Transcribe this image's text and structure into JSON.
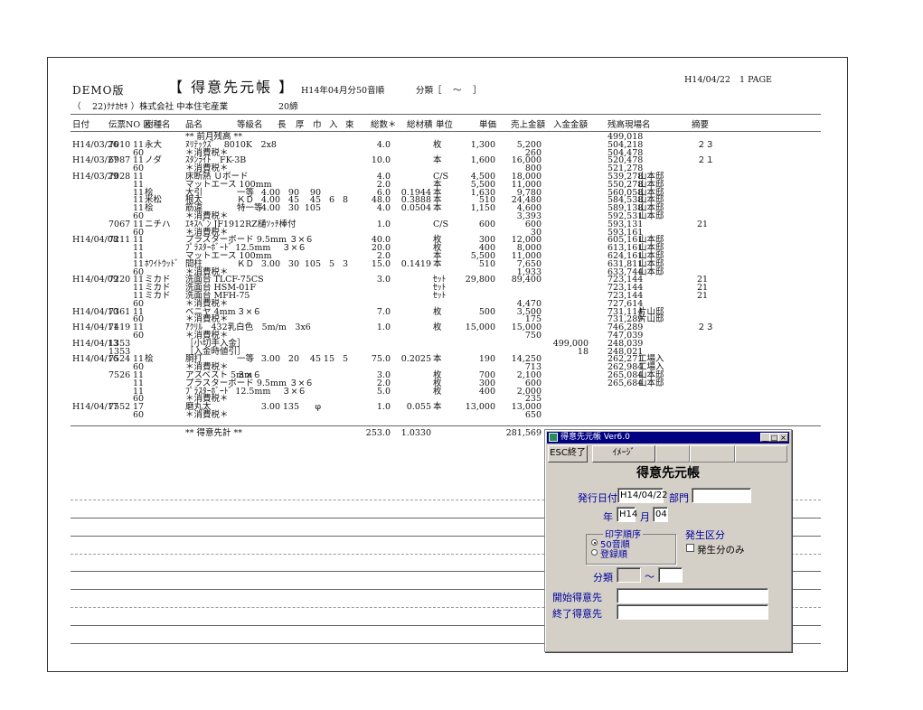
{
  "report": {
    "demo_label": "DEMO版",
    "title": "【 得意先元帳 】",
    "period": "H14年04月分",
    "sort": "50音順",
    "class_range": "分類［　 ～ 　］",
    "print_date": "H14/04/22",
    "page": "1 PAGE",
    "customer_code": "（ 　22)ｸﾅｶｾｷ ）株式会社 中本住宅産業",
    "closing": "20締",
    "columns": {
      "date": "日付",
      "slip": "伝票NO 区",
      "type": "樹種名",
      "item": "品名",
      "grade": "等級名",
      "length": "長",
      "thick": "厚",
      "width": "巾",
      "qty_in": "入",
      "bundle": "束",
      "total_qty": "総数＊",
      "total_vol": "総材積",
      "unit": "単位",
      "price": "単価",
      "sales": "売上金額",
      "deposit": "入金金額",
      "balance": "残高",
      "site": "現場名",
      "memo": "摘要"
    },
    "rows": [
      {
        "item": "** 前月残高 **",
        "balance": "499,018"
      },
      {
        "date": "H14/03/26",
        "slip": "7010",
        "kbn": "11",
        "type": "永大",
        "item": "ﾇﾘﾃｯｸｽﾞ　8010K　2x8",
        "qty": "4.0",
        "unit": "枚",
        "price": "1,300",
        "sales": "5,200",
        "balance": "504,218",
        "memo": "２３"
      },
      {
        "kbn": "60",
        "item": "＊消費税＊",
        "sales": "260",
        "balance": "504,478"
      },
      {
        "date": "H14/03/27",
        "slip": "6987",
        "kbn": "11",
        "type": "ノダ",
        "item": "ｽﾀﾝﾗｲﾄ　FK-3B",
        "qty": "10.0",
        "unit": "本",
        "price": "1,600",
        "sales": "16,000",
        "balance": "520,478",
        "memo": "２１"
      },
      {
        "kbn": "60",
        "item": "＊消費税＊",
        "sales": "800",
        "balance": "521,278"
      },
      {
        "date": "H14/03/29",
        "slip": "7028",
        "kbn": "11",
        "item": "床断熱 Ｕボード",
        "qty": "4.0",
        "unit": "C/S",
        "price": "4,500",
        "sales": "18,000",
        "balance": "539,278",
        "site": "山本邸"
      },
      {
        "kbn": "11",
        "item": "マットエース 100mm",
        "qty": "2.0",
        "unit": "本",
        "price": "5,500",
        "sales": "11,000",
        "balance": "550,278",
        "site": "山本邸"
      },
      {
        "kbn": "11",
        "type": "桧",
        "item": "大引",
        "grade": "一等",
        "length": "4.00",
        "thick": "90",
        "width": "90",
        "qty": "6.0",
        "vol": "0.1944",
        "unit": "本",
        "price": "1,630",
        "sales": "9,780",
        "balance": "560,058",
        "site": "山本邸"
      },
      {
        "kbn": "11",
        "type": "米松",
        "item": "根太",
        "grade": "ＫＤ",
        "length": "4.00",
        "thick": "45",
        "width": "45",
        "in": "6",
        "bundle": "8",
        "qty": "48.0",
        "vol": "0.3888",
        "unit": "本",
        "price": "510",
        "sales": "24,480",
        "balance": "584,538",
        "site": "山本邸"
      },
      {
        "kbn": "11",
        "type": "桧",
        "item": "筋違",
        "grade": "特一等",
        "length": "4.00",
        "thick": "30",
        "width": "105",
        "qty": "4.0",
        "vol": "0.0504",
        "unit": "本",
        "price": "1,150",
        "sales": "4,600",
        "balance": "589,138",
        "site": "山本邸"
      },
      {
        "kbn": "60",
        "item": "＊消費税＊",
        "sales": "3,393",
        "balance": "592,531",
        "site": "山本邸"
      },
      {
        "slip": "7067",
        "kbn": "11",
        "type": "ニチハ",
        "item": "ｴｷｽﾍﾟﾝ JF1912RZ樋ｿｯﾁ棒付",
        "qty": "1.0",
        "unit": "C/S",
        "price": "600",
        "sales": "600",
        "balance": "593,131",
        "memo": "21"
      },
      {
        "kbn": "60",
        "item": "＊消費税＊",
        "sales": "30",
        "balance": "593,161"
      },
      {
        "date": "H14/04/08",
        "slip": "7211",
        "kbn": "11",
        "item": "プラスターボード 9.5mm ３×６",
        "qty": "40.0",
        "unit": "枚",
        "price": "300",
        "sales": "12,000",
        "balance": "605,161",
        "site": "山本邸"
      },
      {
        "kbn": "11",
        "item": "ﾌﾟﾗｽﾀｰﾎﾞｰﾄﾞ 12.5mm　 ３×６",
        "qty": "20.0",
        "unit": "枚",
        "price": "400",
        "sales": "8,000",
        "balance": "613,161",
        "site": "山本邸"
      },
      {
        "kbn": "11",
        "item": "マットエース 100mm",
        "qty": "2.0",
        "unit": "本",
        "price": "5,500",
        "sales": "11,000",
        "balance": "624,161",
        "site": "山本邸"
      },
      {
        "kbn": "11",
        "type": "ﾎﾜｲﾄｳｯﾄﾞ",
        "item": "間柱",
        "grade": "ＫＤ",
        "length": "3.00",
        "thick": "30",
        "width": "105",
        "in": "5",
        "bundle": "3",
        "qty": "15.0",
        "vol": "0.1419",
        "unit": "本",
        "price": "510",
        "sales": "7,650",
        "balance": "631,811",
        "site": "山本邸"
      },
      {
        "kbn": "60",
        "item": "＊消費税＊",
        "sales": "1,933",
        "balance": "633,744",
        "site": "山本邸"
      },
      {
        "date": "H14/04/09",
        "slip": "7220",
        "kbn": "11",
        "type": "ミカド",
        "item": "洗面台 TLCF-75CS",
        "qty": "3.0",
        "unit": "ｾｯﾄ",
        "price": "29,800",
        "sales": "89,400",
        "balance": "723,144",
        "memo": "21"
      },
      {
        "kbn": "11",
        "type": "ミカド",
        "item": "洗面台 HSM-01F",
        "unit": "ｾｯﾄ",
        "balance": "723,144",
        "memo": "21"
      },
      {
        "kbn": "11",
        "type": "ミカド",
        "item": "洗面台 MFH-75",
        "unit": "ｾｯﾄ",
        "balance": "723,144",
        "memo": "21"
      },
      {
        "kbn": "60",
        "item": "＊消費税＊",
        "sales": "4,470",
        "balance": "727,614"
      },
      {
        "date": "H14/04/10",
        "slip": "7361",
        "kbn": "11",
        "item": "ベニヤ 4mm",
        "grade": "３×６",
        "qty": "7.0",
        "unit": "枚",
        "price": "500",
        "sales": "3,500",
        "balance": "731,114",
        "site": "片山邸"
      },
      {
        "kbn": "60",
        "item": "＊消費税＊",
        "sales": "175",
        "balance": "731,289",
        "site": "片山邸"
      },
      {
        "date": "H14/04/11",
        "slip": "7419",
        "kbn": "11",
        "item": "ｱｸﾘﾙ　432乳白色　5m/m　3x6",
        "qty": "1.0",
        "unit": "枚",
        "price": "15,000",
        "sales": "15,000",
        "balance": "746,289",
        "memo": "２３"
      },
      {
        "kbn": "60",
        "item": "＊消費税＊",
        "sales": "750",
        "balance": "747,039"
      },
      {
        "date": "H14/04/13",
        "slip": "1353",
        "item": "［小切手入金］",
        "deposit": "499,000",
        "balance": "248,039"
      },
      {
        "slip": "1353",
        "item": "［入金時値引］",
        "deposit": "18",
        "balance": "248,021"
      },
      {
        "date": "H14/04/16",
        "slip": "7524",
        "kbn": "11",
        "type": "桧",
        "item": "胴打",
        "grade": "一等",
        "length": "3.00",
        "thick": "20",
        "width": "45",
        "in": "15",
        "bundle": "5",
        "qty": "75.0",
        "vol": "0.2025",
        "unit": "本",
        "price": "190",
        "sales": "14,250",
        "balance": "262,271",
        "site": "工場入"
      },
      {
        "kbn": "60",
        "item": "＊消費税＊",
        "sales": "713",
        "balance": "262,984",
        "site": "工場入"
      },
      {
        "slip": "7526",
        "kbn": "11",
        "item": "アスベスト 5mm",
        "grade": "３×６",
        "qty": "3.0",
        "unit": "枚",
        "price": "700",
        "sales": "2,100",
        "balance": "265,084",
        "site": "山本邸"
      },
      {
        "kbn": "11",
        "item": "プラスターボード 9.5mm ３×６",
        "qty": "2.0",
        "unit": "枚",
        "price": "300",
        "sales": "600",
        "balance": "265,684",
        "site": "山本邸"
      },
      {
        "kbn": "11",
        "item": "ﾌﾟﾗｽﾀｰﾎﾞｰﾄﾞ 12.5mm　 ３×６",
        "qty": "5.0",
        "unit": "枚",
        "price": "400",
        "sales": "2,000"
      },
      {
        "kbn": "60",
        "item": "＊消費税＊",
        "sales": "235"
      },
      {
        "date": "H14/04/17",
        "slip": "7552",
        "kbn": "17",
        "item": "磨丸太",
        "length": "3.00",
        "thick": "135",
        "width": "φ",
        "qty": "1.0",
        "vol": "0.055",
        "unit": "本",
        "price": "13,000",
        "sales": "13,000"
      },
      {
        "kbn": "60",
        "item": "＊消費税＊",
        "sales": "650"
      }
    ],
    "total": {
      "label": "** 得意先計 **",
      "qty": "253.0",
      "vol": "1.0330",
      "sales": "281,569"
    }
  },
  "dialog": {
    "title": "得意先元帳 Ver6.0",
    "esc_label": "ESC終了",
    "image_label": "ｲﾒｰｼﾞ",
    "heading": "得意先元帳",
    "issue_date_label": "発行日付",
    "issue_date": "H14/04/22",
    "dept_label": "部門",
    "dept": "",
    "year_label": "年",
    "year": "H14",
    "month_label": "月",
    "month": "04",
    "print_order_label": "印字順序",
    "order_opt1": "50音順",
    "order_opt2": "登録順",
    "occur_label": "発生区分",
    "occur_only": "発生分のみ",
    "class_label": "分類",
    "class_from": "",
    "tilde": "～",
    "class_to": "",
    "start_label": "開始得意先",
    "start_value": "",
    "end_label": "終了得意先",
    "end_value": ""
  }
}
